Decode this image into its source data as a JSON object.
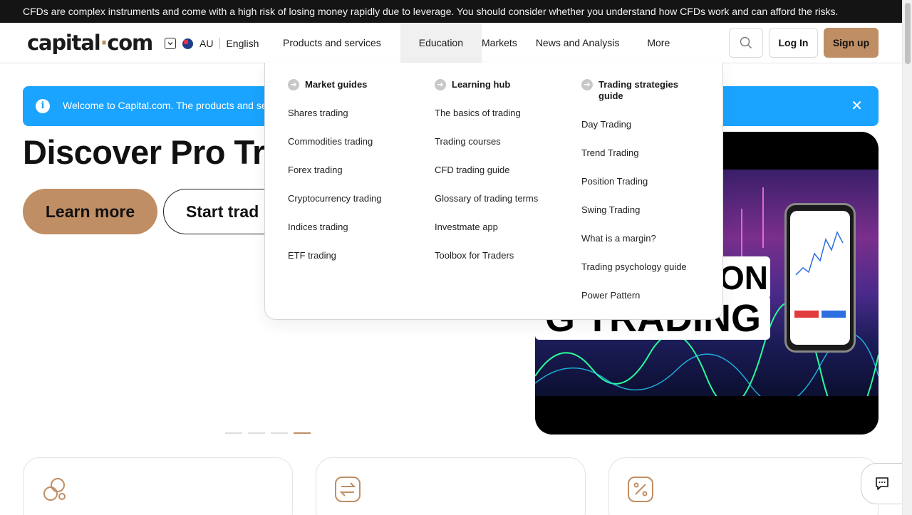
{
  "risk_warning": "CFDs are complex instruments and come with a high risk of losing money rapidly due to leverage. You should consider whether you understand how CFDs work and can afford the risks.",
  "header": {
    "logo_text_a": "capital",
    "logo_text_dot": "·",
    "logo_text_b": "com",
    "region": "AU",
    "language": "English",
    "nav": [
      "Products and services",
      "Education",
      "Markets",
      "News and Analysis",
      "More"
    ],
    "login": "Log In",
    "signup": "Sign up"
  },
  "banner": {
    "text": "Welcome to Capital.com. The products and serv",
    "close": "✕"
  },
  "hero": {
    "title": "Discover Pro Tra",
    "learn_more": "Learn more",
    "start_trading": "Start trad",
    "image_text_top": "ON",
    "image_text_main": "G TRADING",
    "slides_total": 4,
    "active_slide": 4
  },
  "education_menu": {
    "columns": [
      {
        "heading": "Market guides",
        "items": [
          "Shares trading",
          "Commodities trading",
          "Forex trading",
          "Cryptocurrency trading",
          "Indices trading",
          "ETF trading"
        ]
      },
      {
        "heading": "Learning hub",
        "items": [
          "The basics of trading",
          "Trading courses",
          "CFD trading guide",
          "Glossary of trading terms",
          "Investmate app",
          "Toolbox for Traders"
        ]
      },
      {
        "heading": "Trading strategies guide",
        "items": [
          "Day Trading",
          "Trend Trading",
          "Position Trading",
          "Swing Trading",
          "What is a margin?",
          "Trading psychology guide",
          "Power Pattern"
        ]
      }
    ]
  },
  "colors": {
    "accent": "#c08e64",
    "banner": "#1aa3ff",
    "risk_bar": "#141414"
  },
  "icons": [
    "search-icon",
    "chevron-down-icon",
    "flag-au-icon",
    "info-icon",
    "close-icon",
    "arrow-right-icon",
    "coins-icon",
    "exchange-icon",
    "percent-icon",
    "chat-icon"
  ]
}
